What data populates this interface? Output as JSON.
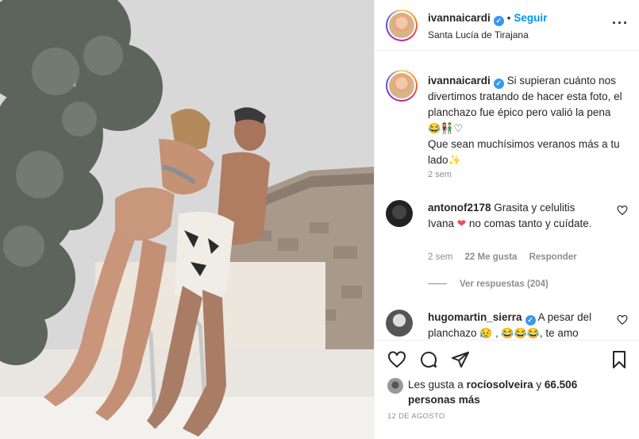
{
  "header": {
    "username": "ivannaicardi",
    "verified_mark": "✓",
    "separator": "•",
    "follow_label": "Seguir",
    "location": "Santa Lucía de Tirajana",
    "more_label": "···"
  },
  "caption": {
    "username": "ivannaicardi",
    "text_line1": "Si supieran cuánto nos divertimos tratando de hacer esta foto, el planchazo fue épico pero valió la pena",
    "emojis1": "😂👫♡",
    "text_line2": "Que sean muchísimos veranos más a tu lado",
    "emojis2": "✨",
    "time": "2 sem"
  },
  "comments": [
    {
      "username": "antonof2178",
      "text_a": "Grasita y celulitis Ivana",
      "heart": "❤",
      "text_b": "no comas tanto y cuídate.",
      "time": "2 sem",
      "likes": "22 Me gusta",
      "reply": "Responder",
      "view_replies": "Ver respuestas (204)"
    },
    {
      "username": "hugomartin_sierra",
      "text_a": "A pesar del planchazo",
      "emojis": "😥 , 😂😂😂",
      "text_b": ", te amo"
    }
  ],
  "likes": {
    "prefix": "Les gusta a",
    "user": "rocíosolveira",
    "middle": "y",
    "count": "66.506 personas más"
  },
  "date": "12 DE AGOSTO",
  "icons": [
    "heart-icon",
    "comment-icon",
    "share-icon",
    "bookmark-icon",
    "more-icon",
    "verified-icon"
  ],
  "colors": {
    "accent": "#0095f6",
    "verified": "#3897f0",
    "muted": "#8e8e8e",
    "heart": "#ed4956"
  }
}
